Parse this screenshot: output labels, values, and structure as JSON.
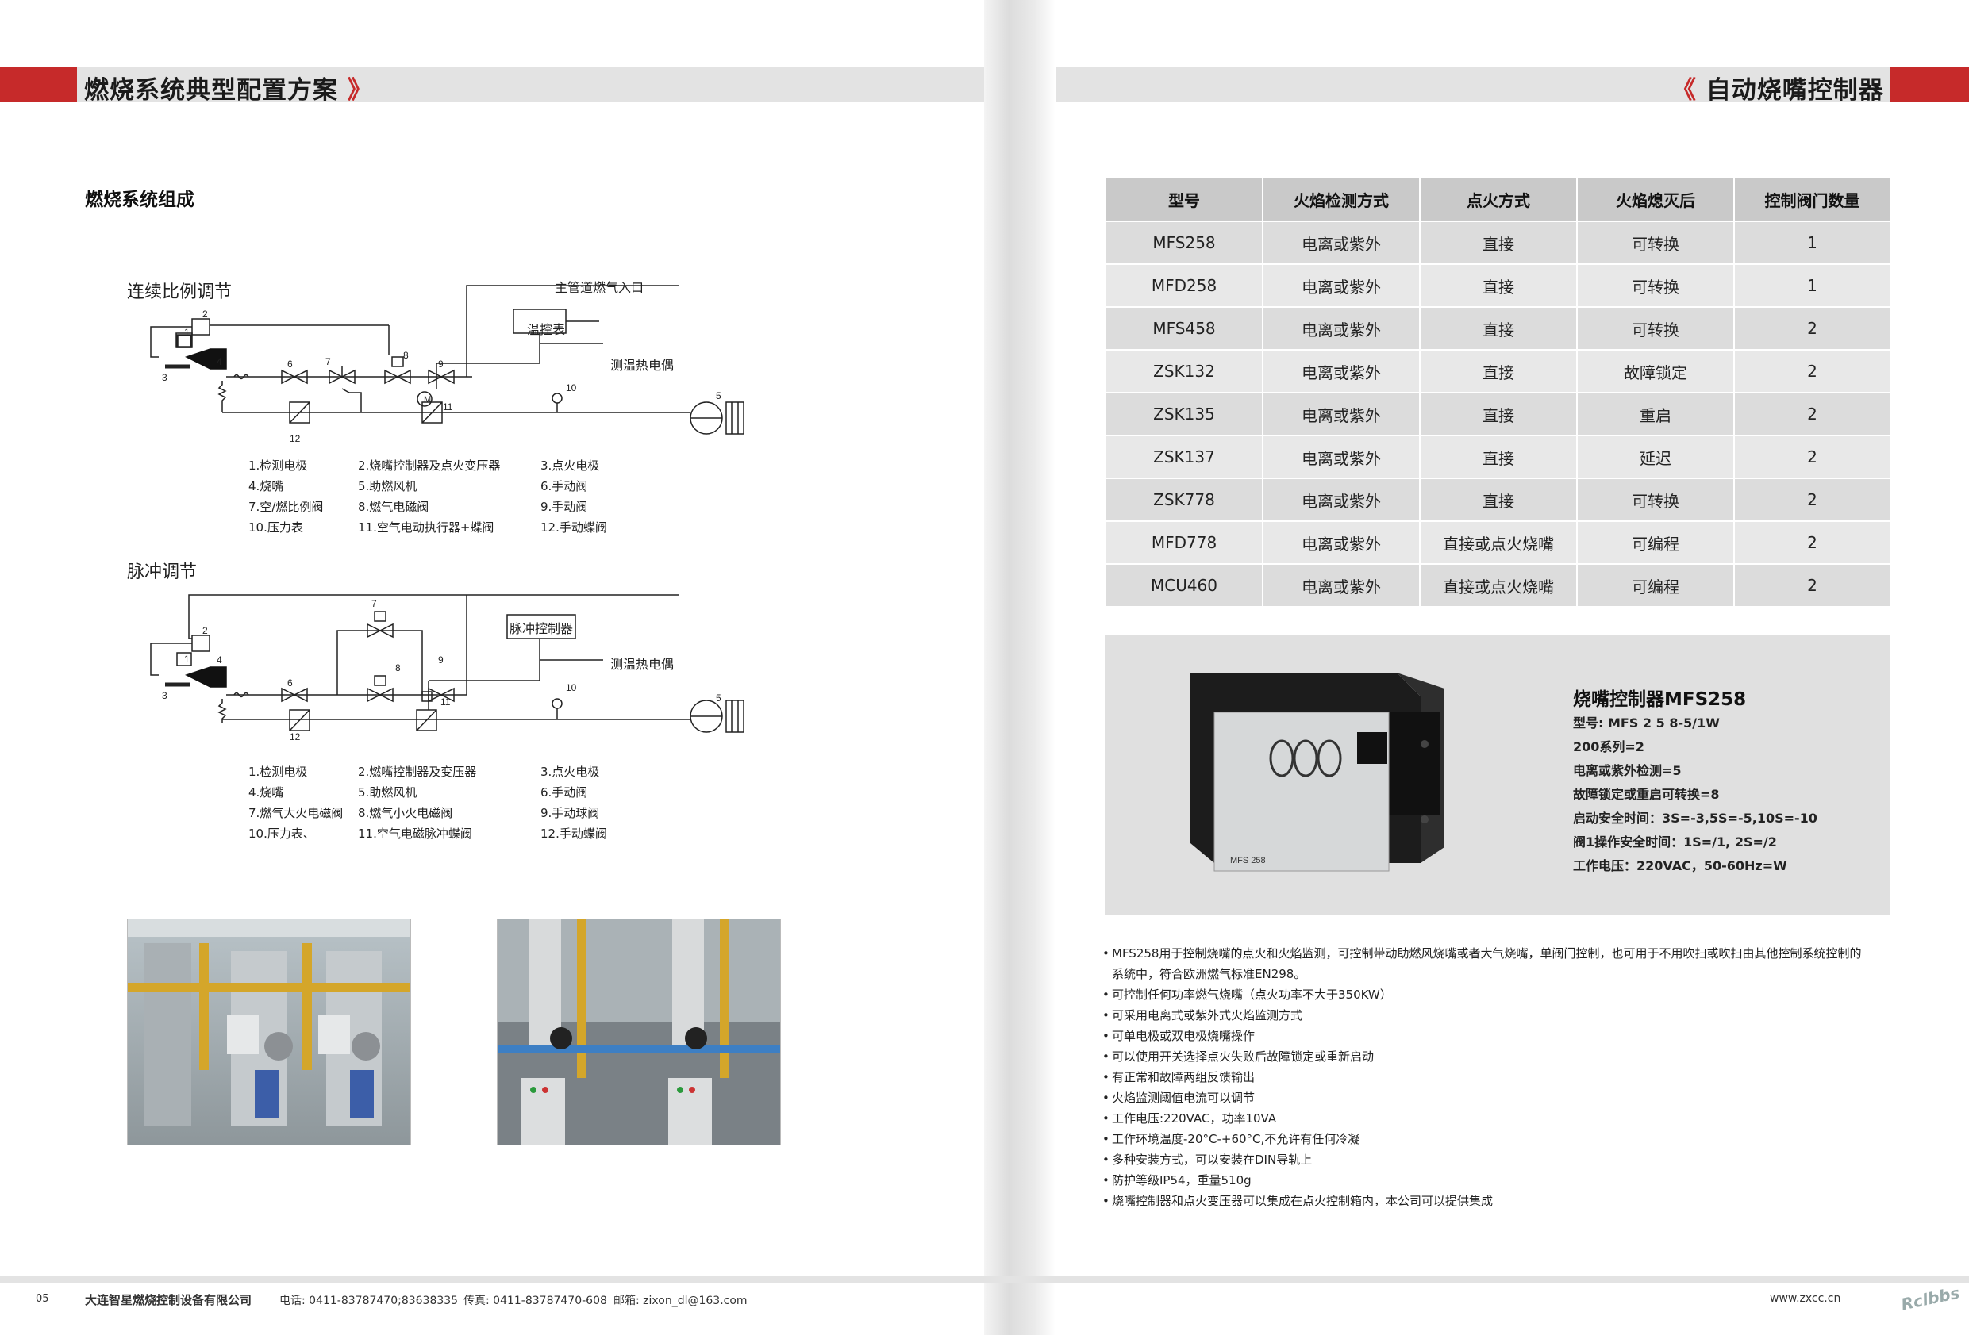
{
  "left_header": {
    "title": "燃烧系统典型配置方案",
    "chevron": "》"
  },
  "right_header": {
    "title": "自动烧嘴控制器",
    "chevron": "《"
  },
  "section_title": "燃烧系统组成",
  "diagram1": {
    "title": "连续比例调节",
    "labels": {
      "inlet": "主管道燃气入口",
      "box": "温控表",
      "thermo": "测温热电偶",
      "motor": "M"
    },
    "legend": [
      [
        "1.检测电极",
        "2.烧嘴控制器及点火变压器",
        "3.点火电极"
      ],
      [
        "4.烧嘴",
        "5.助燃风机",
        "6.手动阀"
      ],
      [
        "7.空/燃比例阀",
        "8.燃气电磁阀",
        "9.手动阀"
      ],
      [
        "10.压力表",
        "11.空气电动执行器+蝶阀",
        "12.手动蝶阀"
      ]
    ]
  },
  "diagram2": {
    "title": "脉冲调节",
    "labels": {
      "box": "脉冲控制器",
      "thermo": "测温热电偶"
    },
    "legend": [
      [
        "1.检测电极",
        "2.燃嘴控制器及变压器",
        "3.点火电极"
      ],
      [
        "4.烧嘴",
        "5.助燃风机",
        "6.手动阀"
      ],
      [
        "7.燃气大火电磁阀",
        "8.燃气小火电磁阀",
        "9.手动球阀"
      ],
      [
        "10.压力表、",
        "11.空气电磁脉冲蝶阀",
        "12.手动蝶阀"
      ]
    ]
  },
  "table": {
    "headers": [
      "型号",
      "火焰检测方式",
      "点火方式",
      "火焰熄灭后",
      "控制阀门数量"
    ],
    "rows": [
      [
        "MFS258",
        "电离或紫外",
        "直接",
        "可转换",
        "1"
      ],
      [
        "MFD258",
        "电离或紫外",
        "直接",
        "可转换",
        "1"
      ],
      [
        "MFS458",
        "电离或紫外",
        "直接",
        "可转换",
        "2"
      ],
      [
        "ZSK132",
        "电离或紫外",
        "直接",
        "故障锁定",
        "2"
      ],
      [
        "ZSK135",
        "电离或紫外",
        "直接",
        "重启",
        "2"
      ],
      [
        "ZSK137",
        "电离或紫外",
        "直接",
        "延迟",
        "2"
      ],
      [
        "ZSK778",
        "电离或紫外",
        "直接",
        "可转换",
        "2"
      ],
      [
        "MFD778",
        "电离或紫外",
        "直接或点火烧嘴",
        "可编程",
        "2"
      ],
      [
        "MCU460",
        "电离或紫外",
        "直接或点火烧嘴",
        "可编程",
        "2"
      ]
    ]
  },
  "product": {
    "title": "烧嘴控制器MFS258",
    "device_label": "MFS 258",
    "lines": [
      "型号: MFS  2 5 8-5/1W",
      "200系列=2",
      "电离或紫外检测=5",
      "故障锁定或重启可转换=8",
      "启动安全时间：3S=-3,5S=-5,10S=-10",
      "阀1操作安全时间：1S=/1, 2S=/2",
      "工作电压：220VAC，50-60Hz=W"
    ]
  },
  "bullets": [
    "MFS258用于控制烧嘴的点火和火焰监测，可控制带动助燃风烧嘴或者大气烧嘴，单阀门控制，也可用于不用吹扫或吹扫由其他控制系统控制的",
    "系统中，符合欧洲燃气标准EN298。",
    "可控制任何功率燃气烧嘴（点火功率不大于350KW）",
    "可采用电离式或紫外式火焰监测方式",
    "可单电极或双电极烧嘴操作",
    "可以使用开关选择点火失败后故障锁定或重新启动",
    "有正常和故障两组反馈输出",
    "火焰监测阈值电流可以调节",
    "工作电压:220VAC，功率10VA",
    "工作环境温度-20°C-+60°C,不允许有任何冷凝",
    "多种安装方式，可以安装在DIN导轨上",
    "防护等级IP54，重量510g",
    "烧嘴控制器和点火变压器可以集成在点火控制箱内，本公司可以提供集成"
  ],
  "footer": {
    "page": "05",
    "company": "大连智星燃烧控制设备有限公司",
    "phone": "电话: 0411-83787470;83638335",
    "fax": "传真: 0411-83787470-608",
    "email": "邮箱: zixon_dl@163.com",
    "website": "www.zxcc.cn",
    "watermark": "Rclbbs"
  },
  "colors": {
    "accent_red": "#c62a2a",
    "header_gray": "#e3e3e3",
    "table_header": "#c9c9c9"
  }
}
